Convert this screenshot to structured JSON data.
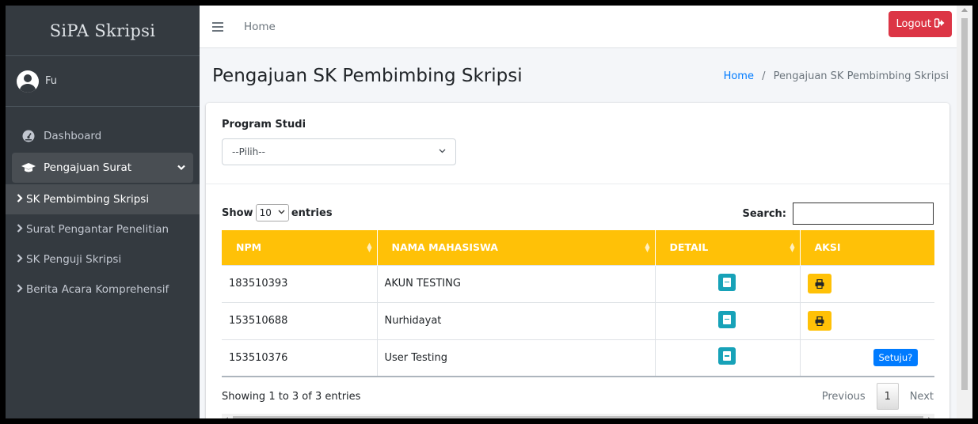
{
  "brand": "SiPA Skripsi",
  "user": {
    "name": "Fu"
  },
  "sidebar": {
    "dashboard": "Dashboard",
    "pengajuan": "Pengajuan Surat",
    "items": [
      {
        "label": "SK Pembimbing Skripsi"
      },
      {
        "label": "Surat Pengantar Penelitian"
      },
      {
        "label": "SK Penguji Skripsi"
      },
      {
        "label": "Berita Acara Komprehensif"
      }
    ]
  },
  "topbar": {
    "home": "Home",
    "logout": "Logout"
  },
  "header": {
    "title": "Pengajuan SK Pembimbing Skripsi"
  },
  "breadcrumb": {
    "home": "Home",
    "sep": "/",
    "current": "Pengajuan SK Pembimbing Skripsi"
  },
  "filter": {
    "label": "Program Studi",
    "selected": "--Pilih--"
  },
  "datatable": {
    "show": "Show",
    "length": "10",
    "entries": "entries",
    "search_label": "Search:",
    "columns": [
      "NPM",
      "NAMA MAHASISWA",
      "DETAIL",
      "AKSI"
    ],
    "rows": [
      {
        "npm": "183510393",
        "nama": "AKUN TESTING",
        "aksi": "print"
      },
      {
        "npm": "153510688",
        "nama": "Nurhidayat",
        "aksi": "print"
      },
      {
        "npm": "153510376",
        "nama": "User Testing",
        "aksi": "setuju",
        "setuju_label": "Setuju?"
      }
    ],
    "info": "Showing 1 to 3 of 3 entries",
    "prev": "Previous",
    "page": "1",
    "next": "Next"
  },
  "colors": {
    "sidebar": "#343a40",
    "header_row": "#ffc107",
    "logout": "#dc3545",
    "detail": "#17a2b8",
    "primary": "#007bff"
  },
  "icons": [
    "user-avatar-icon",
    "dashboard-icon",
    "graduation-cap-icon",
    "chevron-down-icon",
    "chevron-right-icon",
    "hamburger-icon",
    "sign-out-icon",
    "book-icon",
    "print-icon"
  ]
}
